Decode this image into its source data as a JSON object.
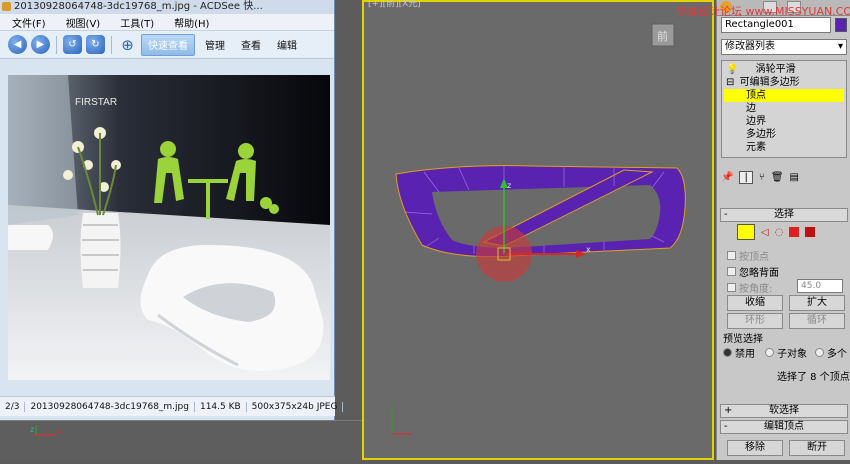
{
  "acdsee": {
    "title": "20130928064748-3dc19768_m.jpg - ACDSee 快...",
    "menu": [
      "文件(F)",
      "视图(V)",
      "工具(T)",
      "帮助(H)"
    ],
    "tabs": [
      "快速查看",
      "管理",
      "查看",
      "编辑"
    ],
    "active_tab": "快速查看",
    "photo_sign": "FIRSTAR",
    "status": {
      "index": "2/3",
      "filename": "20130928064748-3dc19768_m.jpg",
      "size": "114.5 KB",
      "dims": "500x375x24b JPEG"
    }
  },
  "viewport": {
    "label": "[+][前][X光]",
    "cube_face": "前",
    "axis_x": "x",
    "axis_z": "z"
  },
  "bottom_axes": {
    "x": "x",
    "z": "z"
  },
  "watermark": "思缘设计论坛 www.MISSYUAN.COM",
  "panel": {
    "object_name": "Rectangle001",
    "modifier_list": "修改器列表",
    "stack": [
      {
        "label": "涡轮平滑",
        "level": 0
      },
      {
        "label": "可编辑多边形",
        "level": 0
      },
      {
        "label": "顶点",
        "level": 1,
        "selected": true
      },
      {
        "label": "边",
        "level": 1
      },
      {
        "label": "边界",
        "level": 1
      },
      {
        "label": "多边形",
        "level": 1
      },
      {
        "label": "元素",
        "level": 1
      }
    ],
    "select_rollout": "选择",
    "by_vertex": "按顶点",
    "ignore_backfacing": "忽略背面",
    "by_angle": "按角度:",
    "angle_value": "45.0",
    "shrink": "收缩",
    "grow": "扩大",
    "ring": "环形",
    "loop": "循环",
    "preview_title": "预览选择",
    "preview_options": [
      "禁用",
      "子对象",
      "多个"
    ],
    "selection_info": "选择了 8 个顶点",
    "soft_select": "软选择",
    "edit_vertices": "编辑顶点",
    "remove": "移除",
    "break": "断开"
  },
  "colors": {
    "viewport_border": "#e3d400",
    "object": "#5a22b0",
    "selected_stack": "#ffff00"
  }
}
